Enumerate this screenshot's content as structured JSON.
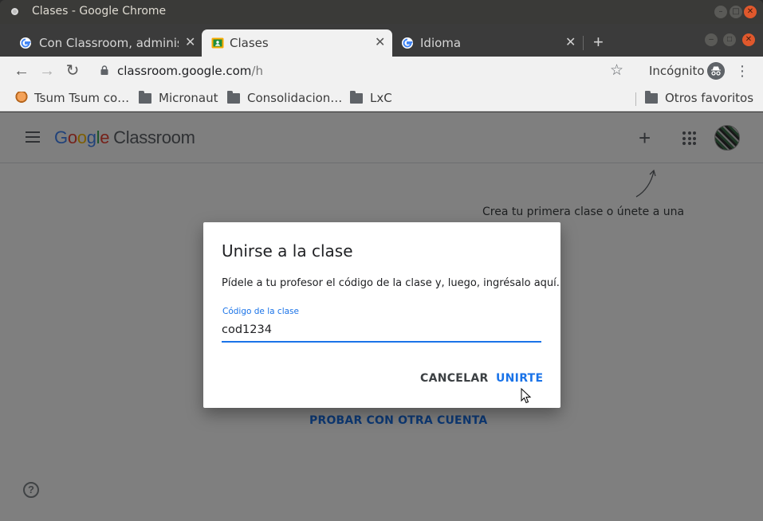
{
  "window": {
    "title": "Clases - Google Chrome"
  },
  "tabs": [
    {
      "label": "Con Classroom, administ",
      "active": false,
      "favicon": "google-g-icon"
    },
    {
      "label": "Clases",
      "active": true,
      "favicon": "classroom-icon"
    },
    {
      "label": "Idioma",
      "active": false,
      "favicon": "google-g-icon"
    }
  ],
  "toolbar": {
    "url_host": "classroom.google.com",
    "url_path": "/h",
    "incognito_label": "Incógnito"
  },
  "bookmarks": [
    {
      "label": "Tsum Tsum co…",
      "icon": "tsum-favicon"
    },
    {
      "label": "Micronaut",
      "icon": "folder-icon"
    },
    {
      "label": "Consolidacion…",
      "icon": "folder-icon"
    },
    {
      "label": "LxC",
      "icon": "folder-icon"
    },
    {
      "label": "Otros favoritos",
      "icon": "folder-icon"
    }
  ],
  "classroom": {
    "logo_google": "Google",
    "logo_product": "Classroom",
    "hint": "Crea tu primera clase o únete a una",
    "alt_account": "PROBAR CON OTRA CUENTA"
  },
  "dialog": {
    "title": "Unirse a la clase",
    "description": "Pídele a tu profesor el código de la clase y, luego, ingrésalo aquí.",
    "field_label": "Código de la clase",
    "field_value": "cod1234",
    "cancel_label": "CANCELAR",
    "join_label": "UNIRTE"
  },
  "colors": {
    "accent": "#1a73e8",
    "titlebar": "#3a3a38",
    "close_button": "#e0582c"
  }
}
